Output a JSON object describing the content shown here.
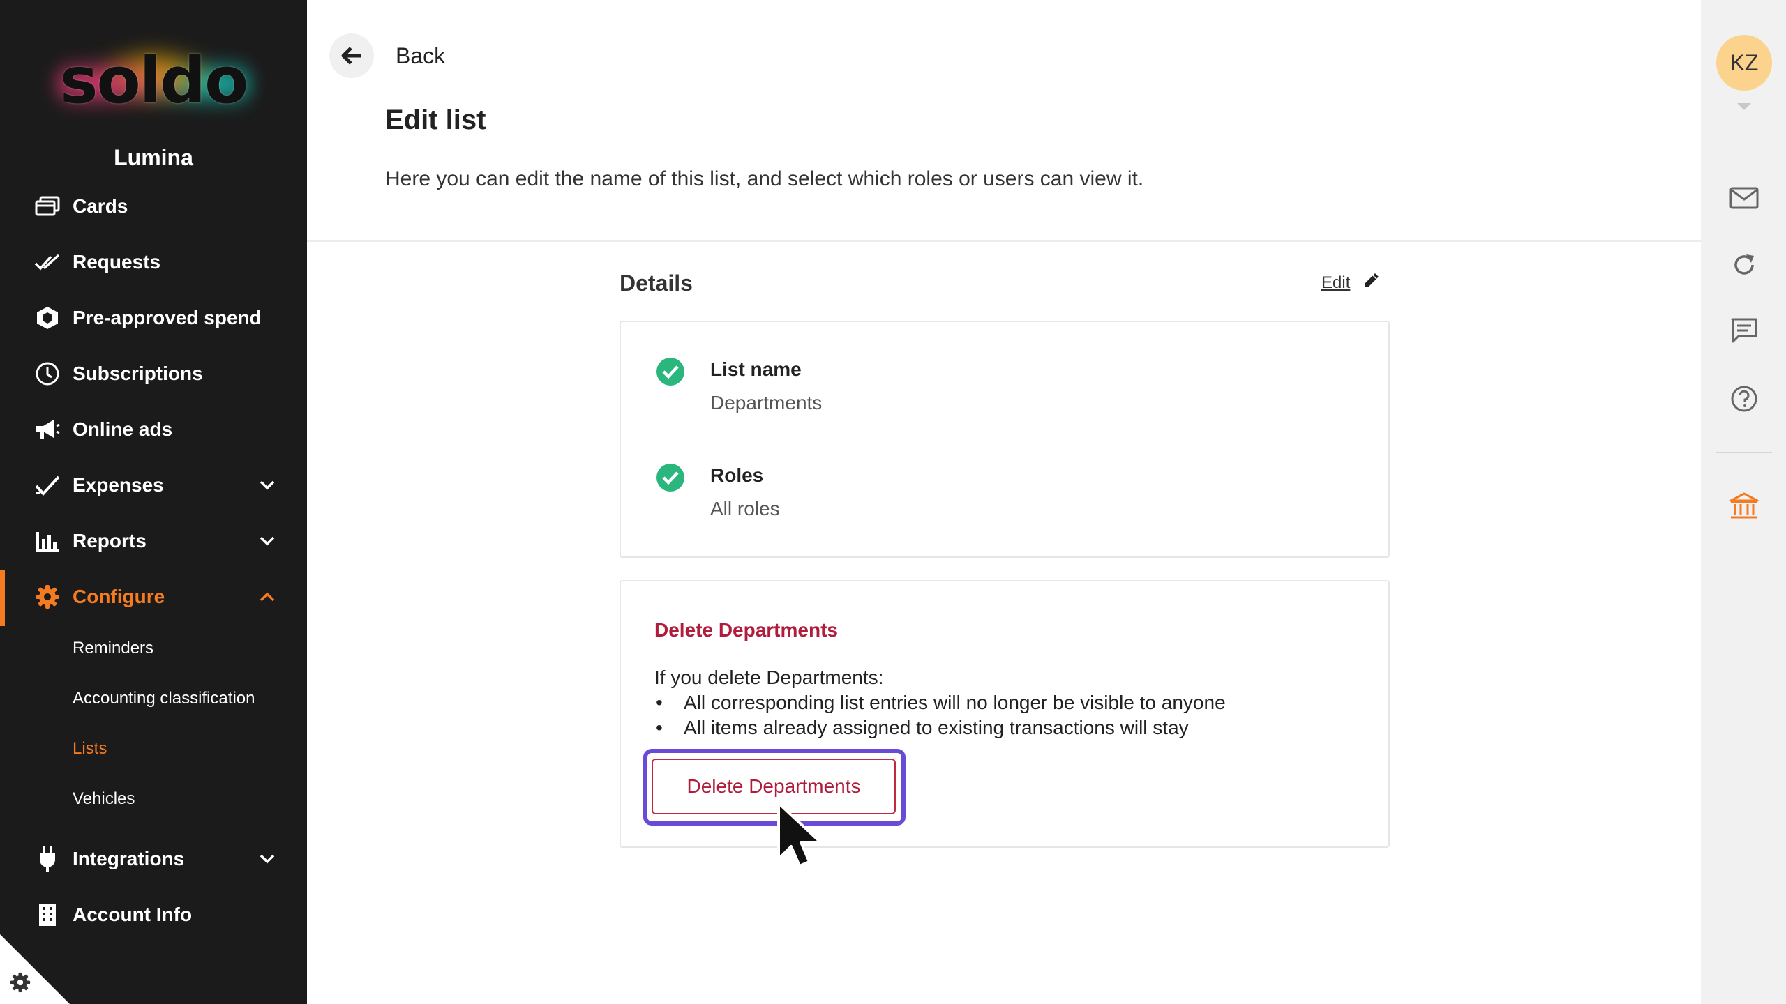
{
  "sidebar": {
    "logo_text": "soldo",
    "org_name": "Lumina",
    "items": [
      {
        "label": "Cards",
        "icon": "cards-icon"
      },
      {
        "label": "Requests",
        "icon": "double-check-icon"
      },
      {
        "label": "Pre-approved spend",
        "icon": "hexagon-icon"
      },
      {
        "label": "Subscriptions",
        "icon": "clock-icon"
      },
      {
        "label": "Online ads",
        "icon": "megaphone-icon"
      },
      {
        "label": "Expenses",
        "icon": "check-icon",
        "expandable": true
      },
      {
        "label": "Reports",
        "icon": "bar-chart-icon",
        "expandable": true
      },
      {
        "label": "Configure",
        "icon": "gear-icon",
        "expandable": true,
        "expanded": true,
        "active": true
      },
      {
        "label": "Integrations",
        "icon": "plug-icon",
        "expandable": true
      },
      {
        "label": "Account Info",
        "icon": "building-icon"
      }
    ],
    "configure_subitems": [
      {
        "label": "Reminders"
      },
      {
        "label": "Accounting classification"
      },
      {
        "label": "Lists",
        "active": true
      },
      {
        "label": "Vehicles"
      }
    ]
  },
  "header": {
    "back_label": "Back",
    "title": "Edit list",
    "description": "Here you can edit the name of this list, and select which roles or users can view it."
  },
  "details": {
    "section_title": "Details",
    "edit_label": "Edit",
    "fields": [
      {
        "label": "List name",
        "value": "Departments"
      },
      {
        "label": "Roles",
        "value": "All roles"
      }
    ]
  },
  "delete_section": {
    "title": "Delete Departments",
    "intro": "If you delete Departments:",
    "bullets": [
      "All corresponding list entries will no longer be visible to anyone",
      "All items already assigned to existing transactions will stay"
    ],
    "button_label": "Delete Departments"
  },
  "right_rail": {
    "avatar_initials": "KZ",
    "icons": [
      "mail-icon",
      "refresh-icon",
      "chat-icon",
      "help-icon",
      "bank-icon"
    ]
  },
  "colors": {
    "sidebar_bg": "#1b1b1b",
    "accent_orange": "#f47b20",
    "danger_red": "#b01c3c",
    "success_green": "#2bb67d",
    "focus_purple": "#6a4bd8",
    "avatar_bg": "#fbd38d"
  }
}
